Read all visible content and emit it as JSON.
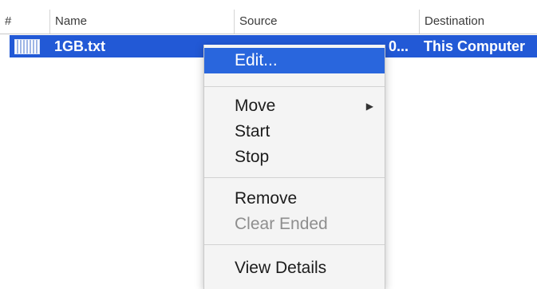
{
  "table": {
    "columns": [
      "#",
      "Name",
      "Source",
      "Destination"
    ],
    "rows": [
      {
        "icon": "file-transfer-icon",
        "name": "1GB.txt",
        "source": "0...",
        "destination": "This Computer"
      }
    ]
  },
  "context_menu": {
    "items": [
      {
        "label": "Edit...",
        "highlighted": true
      },
      {
        "label": "Move",
        "has_submenu": true,
        "arrow": "▶"
      },
      {
        "label": "Start"
      },
      {
        "label": "Stop"
      },
      {
        "label": "Remove"
      },
      {
        "label": "Clear Ended",
        "disabled": true
      },
      {
        "label": "View Details"
      }
    ]
  },
  "colors": {
    "selection": "#2259d6",
    "menu_highlight": "#2966dd",
    "menu_background": "#f4f4f4",
    "disabled_text": "#8e8e8e"
  }
}
